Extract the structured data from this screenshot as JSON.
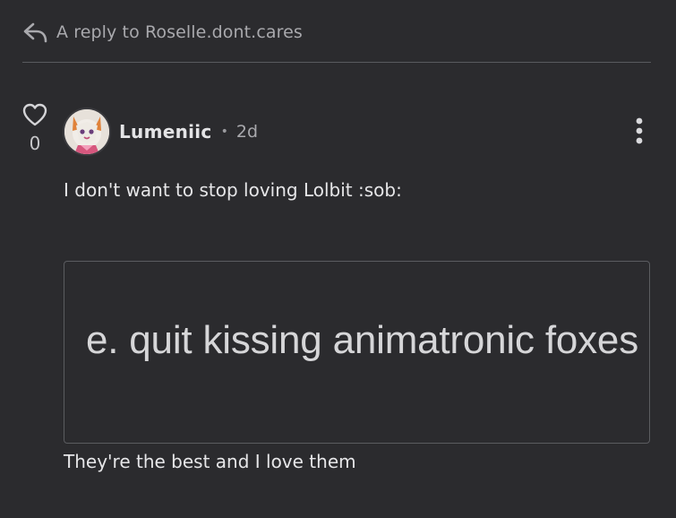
{
  "reply_header": {
    "icon": "reply-arrow-icon",
    "text": "A reply to Roselle.dont.cares"
  },
  "post": {
    "like_icon": "heart-outline-icon",
    "like_count": "0",
    "author": "Lumeniic",
    "separator": "•",
    "time": "2d",
    "menu_icon": "vertical-ellipsis-icon",
    "text": "I don't want to stop loving Lolbit :sob:",
    "embed_image_text": "e. quit kissing animatronic foxes",
    "caption": "They're the best and I love them"
  },
  "colors": {
    "background": "#2b2b2e",
    "text_primary": "#e6e6e8",
    "text_secondary": "#a9a9ad",
    "divider": "#595a5e"
  }
}
